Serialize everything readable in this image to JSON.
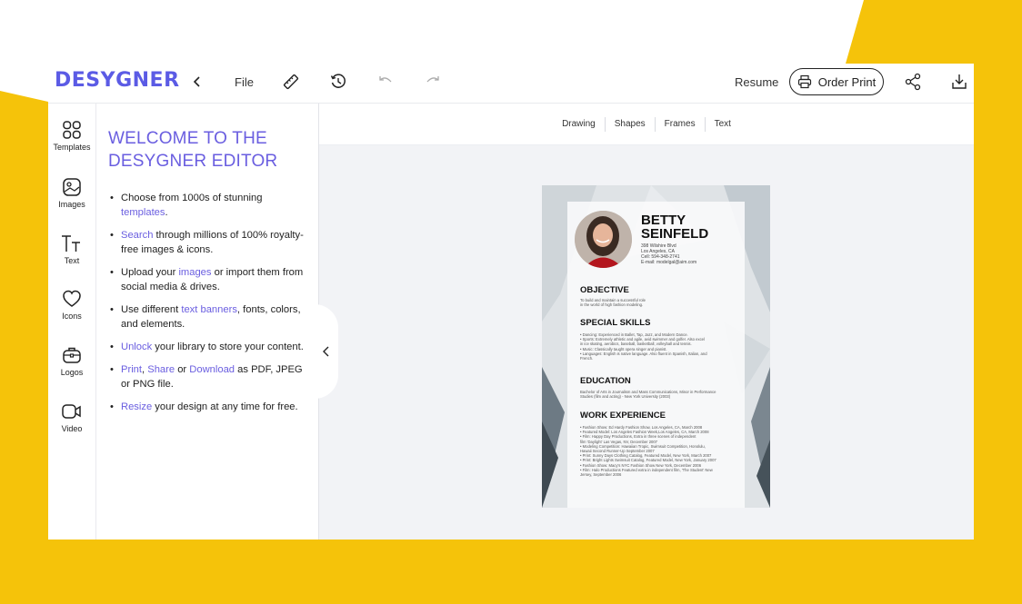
{
  "app": {
    "logo": "DESYGNER",
    "menu_file": "File",
    "resume_label": "Resume",
    "order_print_label": "Order Print",
    "icons": [
      "chevron-left-icon",
      "ruler-icon",
      "history-icon",
      "undo-icon",
      "redo-icon",
      "printer-icon",
      "share-icon",
      "download-icon"
    ]
  },
  "rail": [
    {
      "label": "Templates",
      "icon": "templates-icon"
    },
    {
      "label": "Images",
      "icon": "images-icon"
    },
    {
      "label": "Text",
      "icon": "text-icon"
    },
    {
      "label": "Icons",
      "icon": "heart-icon"
    },
    {
      "label": "Logos",
      "icon": "briefcase-icon"
    },
    {
      "label": "Video",
      "icon": "video-icon"
    }
  ],
  "panel": {
    "title_line1": "WELCOME TO THE",
    "title_line2": "DESYGNER EDITOR",
    "bullets": [
      {
        "pre": "Choose from 1000s of stunning ",
        "link": "templates",
        "post": "."
      },
      {
        "pre": "",
        "link": "Search",
        "post": " through millions of 100% royalty-free images & icons."
      },
      {
        "pre": "Upload your ",
        "link": "images",
        "post": " or import them from social media & drives."
      },
      {
        "pre": "Use different ",
        "link": "text banners",
        "post": ", fonts, colors, and elements."
      },
      {
        "pre": "",
        "link": "Unlock",
        "post": " your library to store your content."
      },
      {
        "link1": "Print",
        "sep1": ", ",
        "link2": "Share",
        "sep2": " or ",
        "link3": "Download",
        "post": " as PDF, JPEG or PNG file."
      },
      {
        "pre": "",
        "link": "Resize",
        "post": " your design at any time for free."
      }
    ]
  },
  "subtabs": [
    "Drawing",
    "Shapes",
    "Frames",
    "Text"
  ],
  "resume": {
    "first_name": "BETTY",
    "last_name": "SEINFELD",
    "address": "398 Wilshire Blvd",
    "city": "Los Angeles, CA",
    "cell": "Cell: 594-348-2741",
    "email": "E-mail: modelgal@aim.com",
    "objective_title": "OBJECTIVE",
    "objective_lines": [
      "To build and maintain a successful role",
      "in the world of high fashion modeling."
    ],
    "skills_title": "SPECIAL SKILLS",
    "skills_lines": [
      "• Dancing: Experienced in Ballet, Tap, Jazz, and Modern Dance.",
      "• Sports: Extremely athletic and agile, avid swimmer and golfer. Also excel",
      "   in ice skating, aerobics, baseball, basketball, volleyball and tennis.",
      "• Music: Classically taught opera singer and pianist.",
      "• Languages: English is native language. Also fluent in Spanish, Italian, and",
      "   French."
    ],
    "education_title": "EDUCATION",
    "education_lines": [
      "Bachelor of Arts in Journalism and Mass Communications, Minor in Performance",
      "Studies (film and acting) - New York University (2003)"
    ],
    "work_title": "WORK EXPERIENCE",
    "work_lines": [
      "• Fashion Show: Ed Hardy Fashion Show, Los Angeles, CA, March 2008",
      "• Featured Model: Los Angeles Fashion Week,Los Angeles, CA, March 2008",
      "• Film: Happy Day Productions, Extra in three scenes of independent",
      "   film 'Daylight' Las Vegas, NV, December 2007",
      "• Modeling Competition: Hawaiian Tropic, Swimsuit Competition, Honolulu,",
      "   Hawaii Second Runner-Up September 2007",
      "• Print: Sunny Days Clothing Catalog, Featured Model, New York, March 2007",
      "• Print: Bright Lights Swimsuit Catalog, Featured Model, New York, January 2007",
      "• Fashion Show: Macy's NYC Fashion Show New York, December 2006",
      "• Film: Halo Productions Featured extra in independent film, 'The Student' New",
      "   Jersey, September 2006"
    ]
  },
  "colors": {
    "brand": "#5b5be5",
    "accent_yellow": "#f5c30a",
    "link": "#6a5ee0"
  }
}
